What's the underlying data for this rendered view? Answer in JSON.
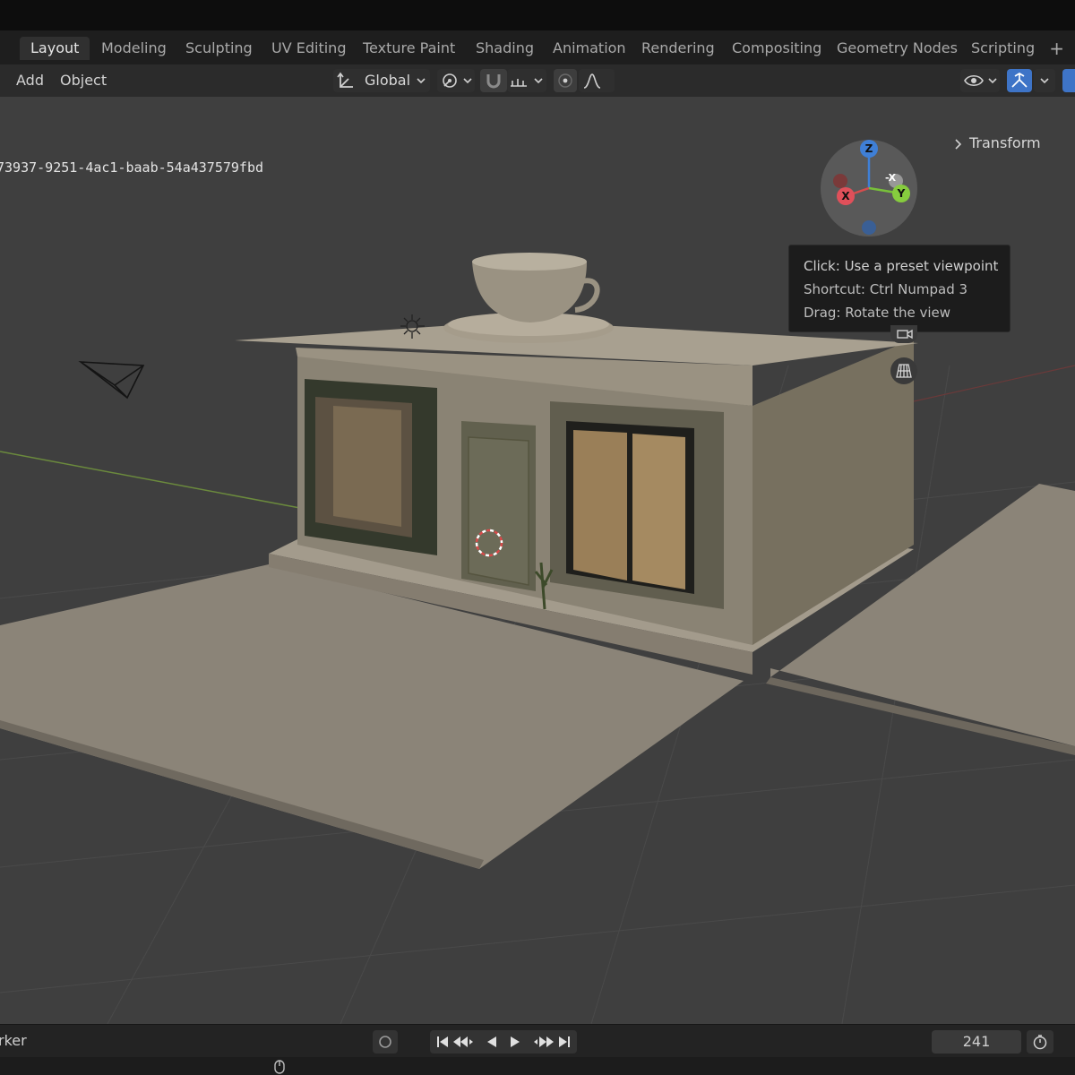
{
  "workspace_tabs": [
    "Layout",
    "Modeling",
    "Sculpting",
    "UV Editing",
    "Texture Paint",
    "Shading",
    "Animation",
    "Rendering",
    "Compositing",
    "Geometry Nodes",
    "Scripting"
  ],
  "active_tab": "Layout",
  "tab_add": "+",
  "header": {
    "menu_add": "Add",
    "menu_object": "Object",
    "transform_orientation": "Global"
  },
  "viewport": {
    "object_id": "73937-9251-4ac1-baab-54a437579fbd",
    "transform_panel": "Transform",
    "gizmo": {
      "z": "Z",
      "x": "X",
      "y": "Y",
      "neg_x": "-X"
    },
    "tooltip": {
      "line1": "Click: Use a preset viewpoint",
      "line2": "Shortcut: Ctrl Numpad 3",
      "line3": "Drag: Rotate the view"
    }
  },
  "timeline": {
    "label": "rker",
    "current_frame": "241"
  }
}
